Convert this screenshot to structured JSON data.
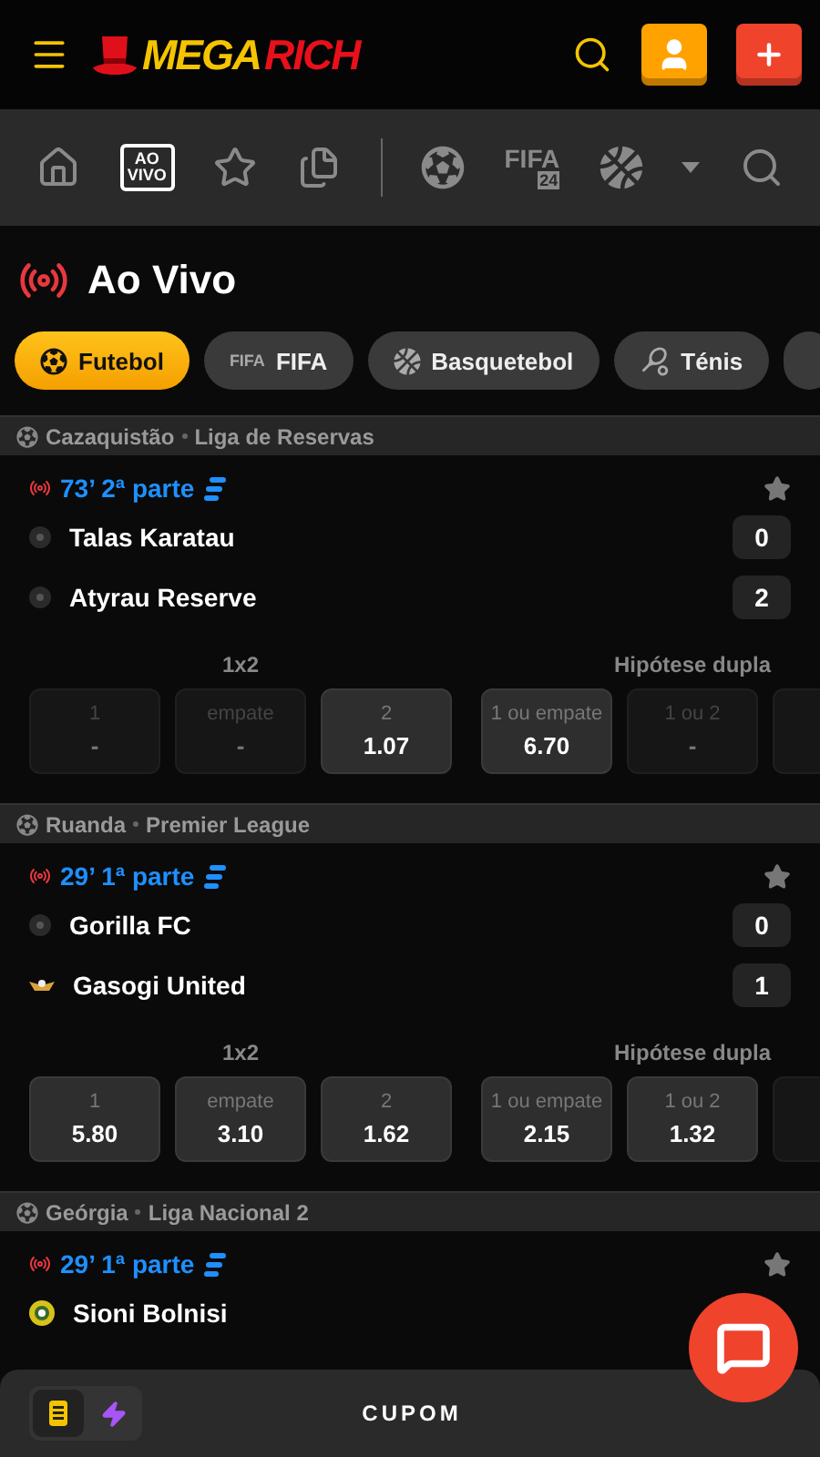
{
  "header": {
    "brand_left": "MEGA",
    "brand_right": "RICH"
  },
  "nav": [
    {
      "kind": "home",
      "selected": false
    },
    {
      "kind": "live",
      "lines": [
        "AO",
        "VIVO"
      ],
      "selected": true
    },
    {
      "kind": "favorites",
      "selected": false
    },
    {
      "kind": "slips",
      "selected": false
    },
    {
      "kind": "divider"
    },
    {
      "kind": "soccer",
      "selected": false
    },
    {
      "kind": "fifa",
      "label": "FIFA",
      "badge": "24",
      "selected": false
    },
    {
      "kind": "basketball",
      "selected": false
    },
    {
      "kind": "caret"
    },
    {
      "kind": "search",
      "selected": false
    }
  ],
  "page_title": "Ao Vivo",
  "chips": [
    {
      "kind": "soccer",
      "label": "Futebol",
      "selected": true
    },
    {
      "kind": "fifa",
      "label": "FIFA",
      "badge": "FIFA",
      "selected": false
    },
    {
      "kind": "basketball",
      "label": "Basquetebol",
      "selected": false
    },
    {
      "kind": "tennis",
      "label": "Ténis",
      "selected": false
    },
    {
      "kind": "cut",
      "selected": false
    }
  ],
  "matches": [
    {
      "country": "Cazaquistão",
      "league": "Liga de Reservas",
      "minute": "73’",
      "period": "2ª parte",
      "favorite": false,
      "teams": [
        {
          "name": "Talas Karatau",
          "kind": "plain",
          "score": "0"
        },
        {
          "name": "Atyrau Reserve",
          "kind": "plain",
          "score": "2"
        }
      ],
      "markets": [
        {
          "title": "1x2",
          "overflow": false,
          "odds": [
            {
              "label": "1",
              "value": "-",
              "disabled": true
            },
            {
              "label": "empate",
              "value": "-",
              "disabled": true
            },
            {
              "label": "2",
              "value": "1.07",
              "disabled": false
            }
          ]
        },
        {
          "title": "Hipótese dupla",
          "overflow": true,
          "odds": [
            {
              "label": "1 ou empate",
              "value": "6.70",
              "disabled": false
            },
            {
              "label": "1 ou 2",
              "value": "-",
              "disabled": true
            }
          ]
        }
      ]
    },
    {
      "country": "Ruanda",
      "league": "Premier League",
      "minute": "29’",
      "period": "1ª parte",
      "favorite": false,
      "teams": [
        {
          "name": "Gorilla FC",
          "kind": "plain",
          "score": "0"
        },
        {
          "name": "Gasogi United",
          "kind": "winged",
          "score": "1"
        }
      ],
      "markets": [
        {
          "title": "1x2",
          "overflow": false,
          "odds": [
            {
              "label": "1",
              "value": "5.80",
              "disabled": false
            },
            {
              "label": "empate",
              "value": "3.10",
              "disabled": false
            },
            {
              "label": "2",
              "value": "1.62",
              "disabled": false
            }
          ]
        },
        {
          "title": "Hipótese dupla",
          "overflow": true,
          "odds": [
            {
              "label": "1 ou empate",
              "value": "2.15",
              "disabled": false
            },
            {
              "label": "1 ou 2",
              "value": "1.32",
              "disabled": false
            }
          ]
        }
      ]
    },
    {
      "country": "Geórgia",
      "league": "Liga Nacional 2",
      "minute": "29’",
      "period": "1ª parte",
      "favorite": false,
      "teams": [
        {
          "name": "Sioni Bolnisi",
          "kind": "crest"
        }
      ]
    }
  ],
  "footer": {
    "modes": [
      {
        "kind": "slip",
        "selected": true
      },
      {
        "kind": "quick",
        "selected": false
      }
    ],
    "label": "CUPOM"
  }
}
